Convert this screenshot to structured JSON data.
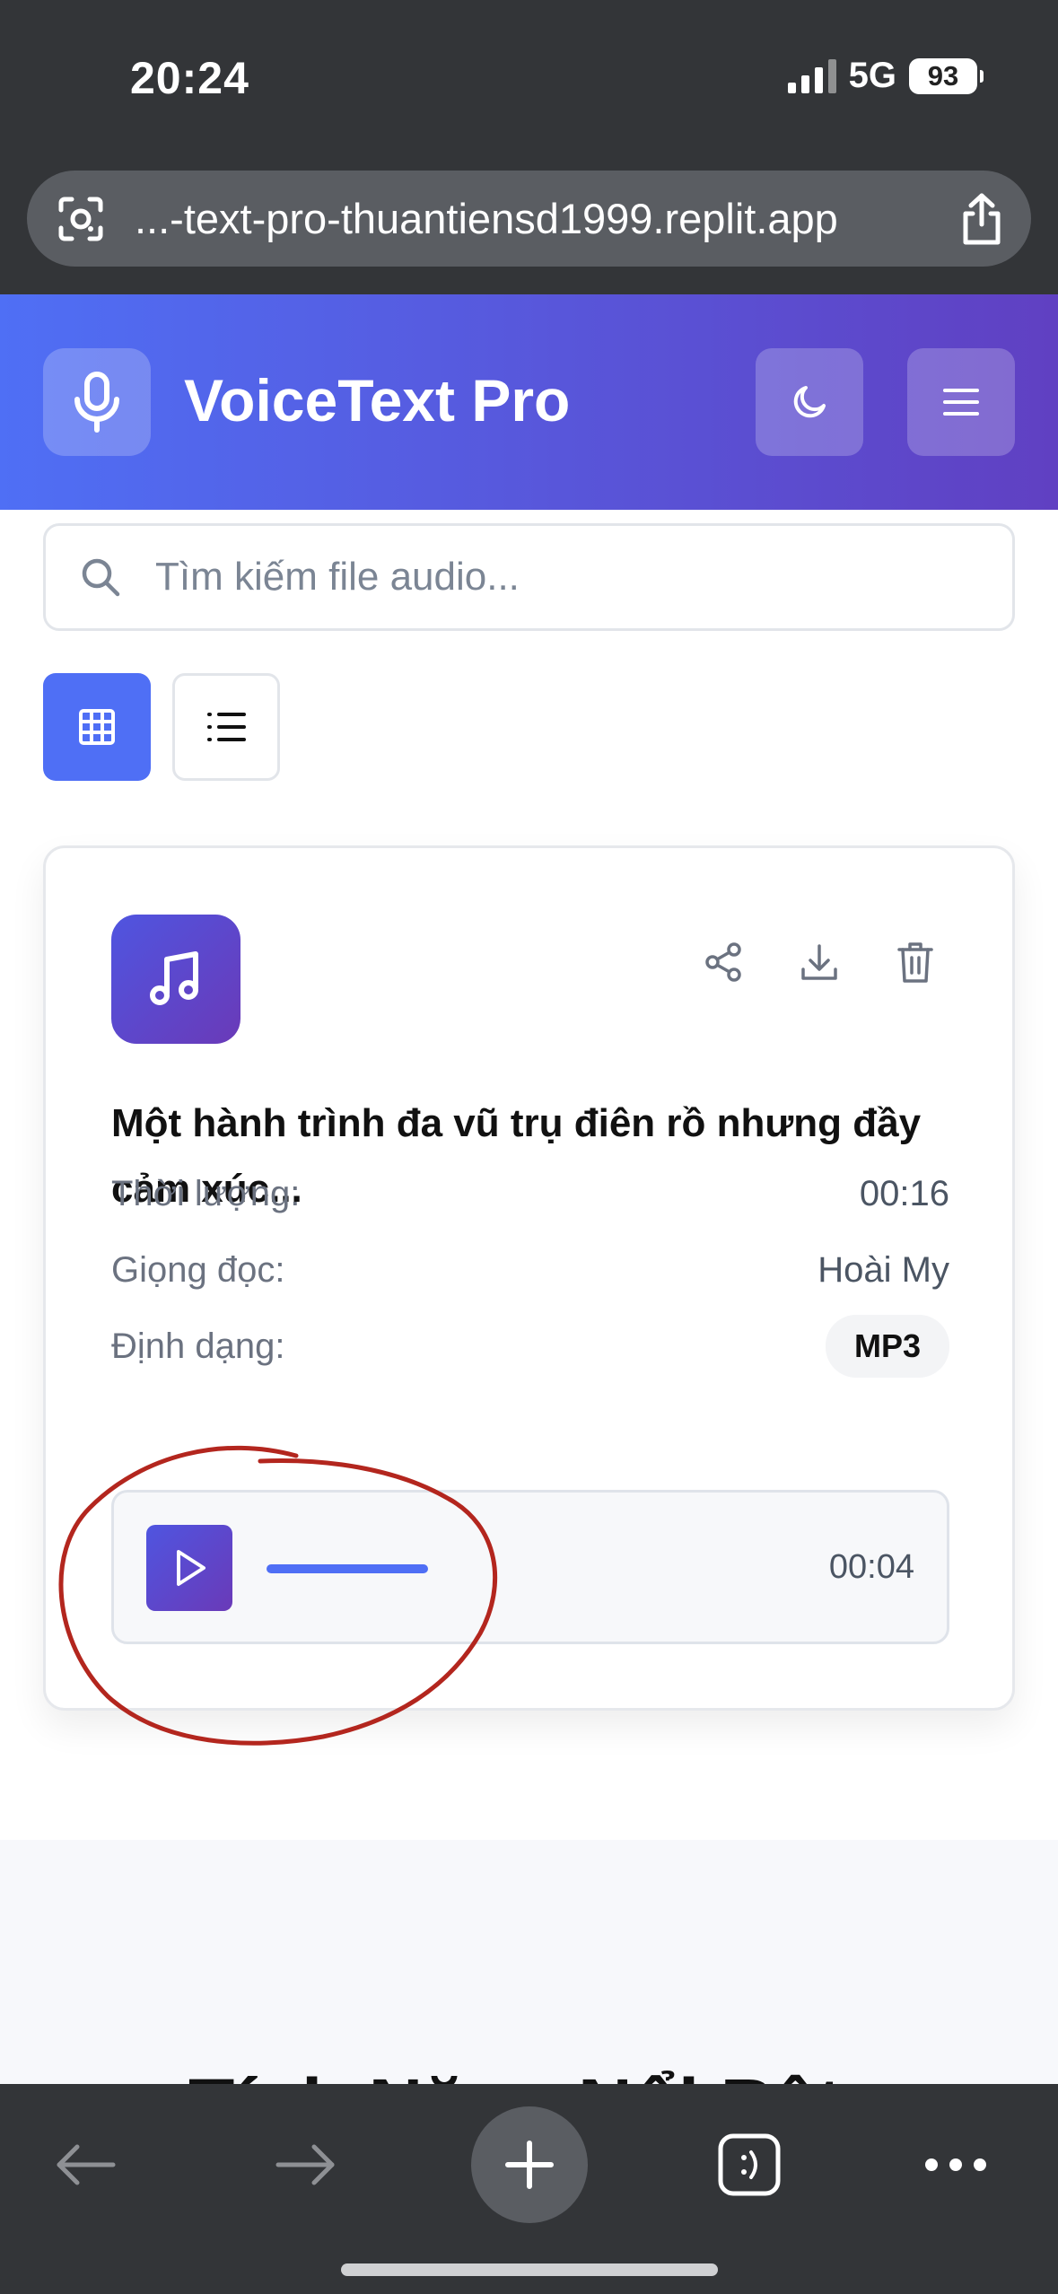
{
  "status_bar": {
    "time": "20:24",
    "network": "5G",
    "battery": "93"
  },
  "browser": {
    "url": "...-text-pro-thuantiensd1999.replit.app"
  },
  "header": {
    "title": "VoiceText Pro"
  },
  "search": {
    "placeholder": "Tìm kiếm file audio..."
  },
  "card": {
    "title": "Một hành trình đa vũ trụ điên rồ nhưng đầy cảm xúc...",
    "duration_label": "Thời lượng:",
    "duration_value": "00:16",
    "voice_label": "Giọng đọc:",
    "voice_value": "Hoài My",
    "format_label": "Định dạng:",
    "format_value": "MP3",
    "player": {
      "time": "00:04",
      "progress": 0.25
    }
  },
  "section": {
    "title": "Tính Năng Nổi Bật"
  },
  "colors": {
    "accent": "#4f6ff5",
    "accent_dark": "#6040c2",
    "annotation": "#b3261e"
  },
  "icons": [
    "lens-icon",
    "share-icon",
    "mic-icon",
    "moon-icon",
    "menu-icon",
    "search-icon",
    "grid-icon",
    "list-icon",
    "music-note-icon",
    "share-nodes-icon",
    "download-icon",
    "trash-icon",
    "play-icon",
    "back-icon",
    "forward-icon",
    "plus-icon",
    "tabs-icon",
    "more-icon"
  ]
}
